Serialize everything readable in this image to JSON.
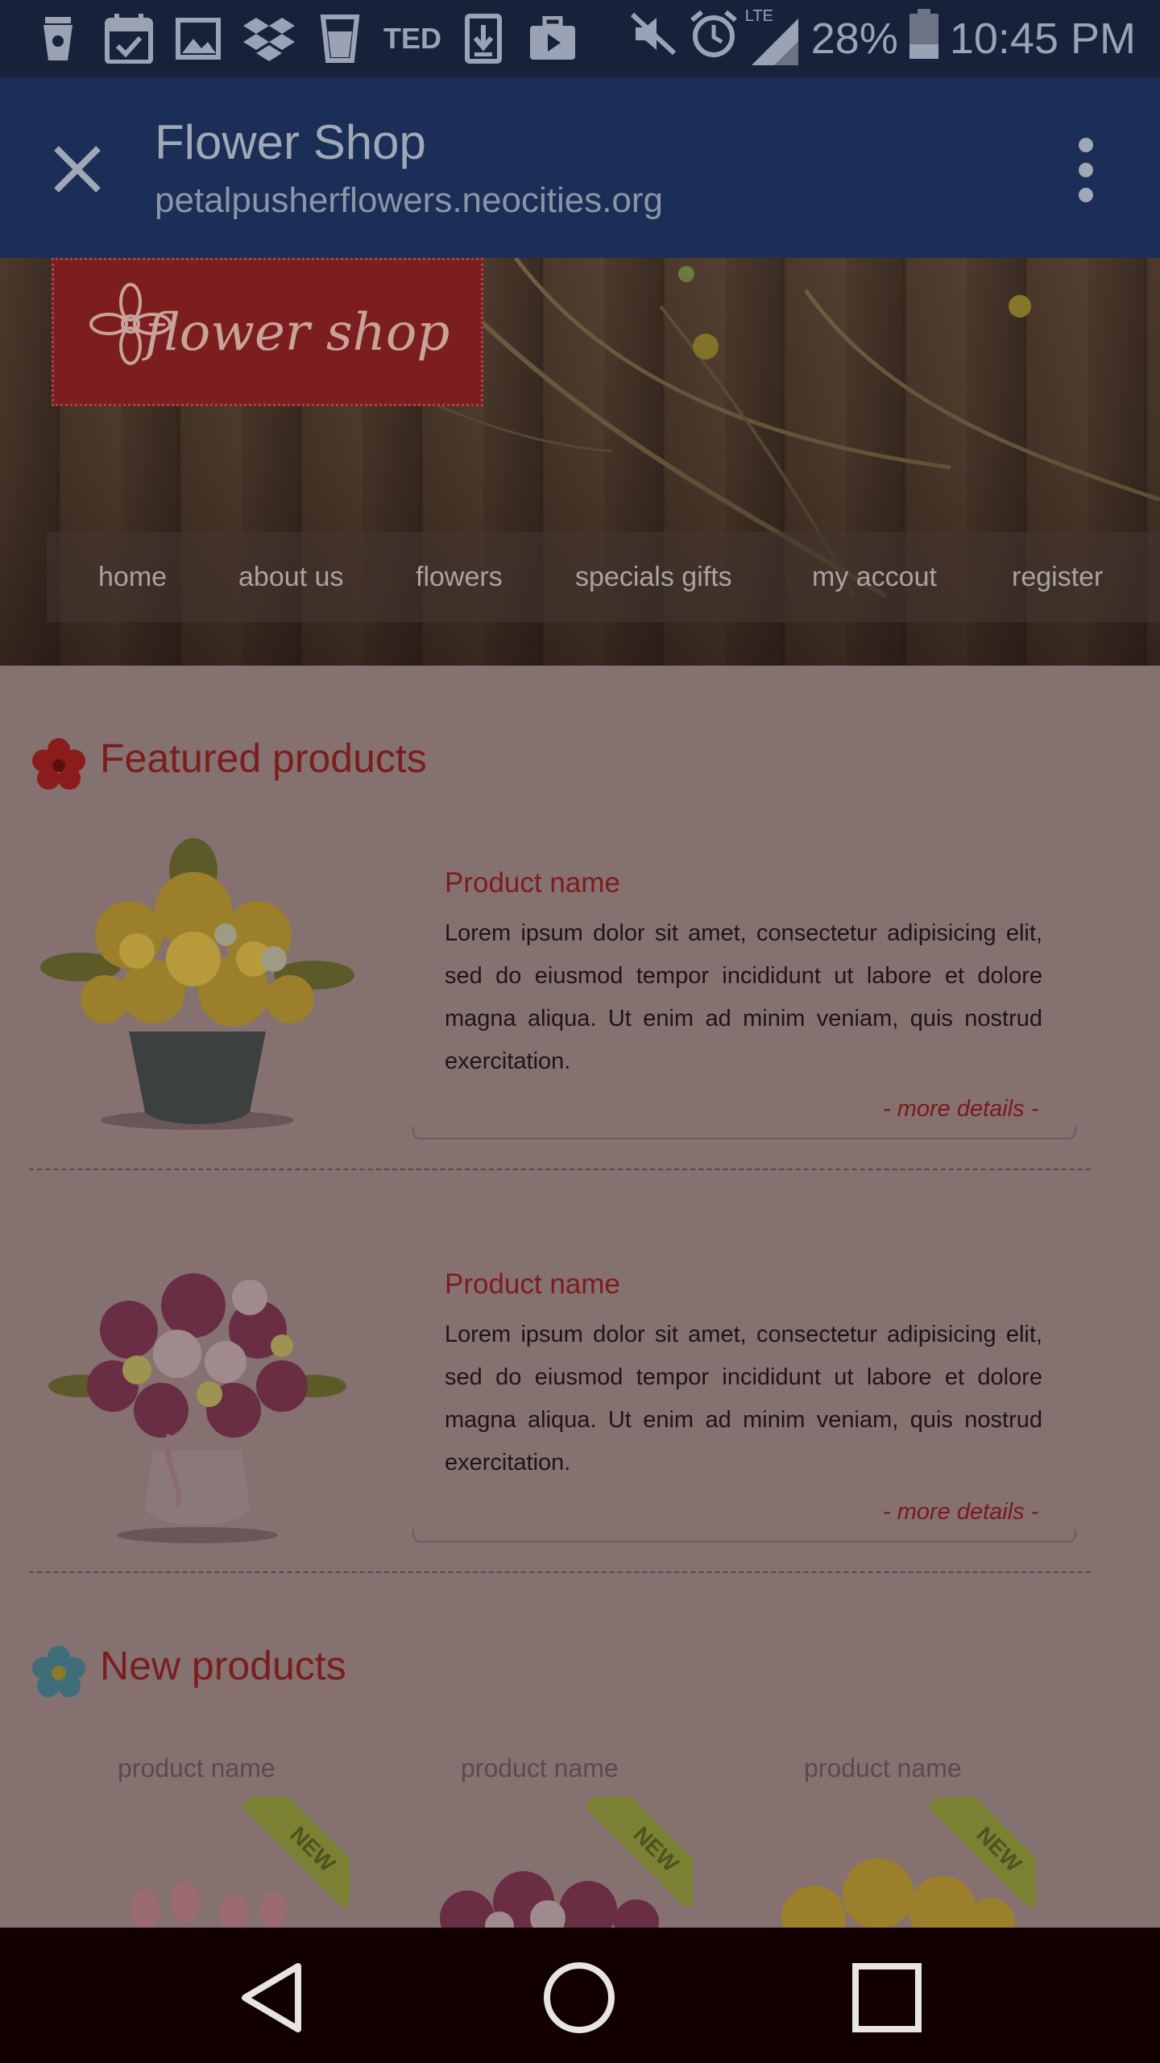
{
  "status_bar": {
    "battery": "28%",
    "time": "10:45 PM",
    "network": "LTE",
    "notification_icons": [
      "coffee-cup-icon",
      "calendar-check-icon",
      "image-icon",
      "dropbox-icon",
      "cup-icon",
      "ted-icon",
      "download-icon",
      "briefcase-play-icon"
    ],
    "ted_label": "TED"
  },
  "app_bar": {
    "title": "Flower Shop",
    "url": "petalpusherflowers.neocities.org"
  },
  "site": {
    "logo_text": "flower shop",
    "nav": [
      "home",
      "about us",
      "flowers",
      "specials gifts",
      "my accout",
      "register"
    ]
  },
  "featured": {
    "title": "Featured products",
    "products": [
      {
        "name": "Product name",
        "description": "Lorem ipsum dolor sit amet, consectetur adipisicing elit, sed do eiusmod tempor incididunt ut labore et dolore magna aliqua. Ut enim ad minim veniam, quis nostrud exercitation.",
        "more": "- more details -"
      },
      {
        "name": "Product name",
        "description": "Lorem ipsum dolor sit amet, consectetur adipisicing elit, sed do eiusmod tempor incididunt ut labore et dolore magna aliqua. Ut enim ad minim veniam, quis nostrud exercitation.",
        "more": "- more details -"
      }
    ]
  },
  "new_products": {
    "title": "New products",
    "items": [
      {
        "name": "product name",
        "badge": "NEW"
      },
      {
        "name": "product name",
        "badge": "NEW"
      },
      {
        "name": "product name",
        "badge": "NEW"
      }
    ]
  },
  "colors": {
    "overlay_page": "#857170",
    "app_bar": "#1a2e57",
    "accent_red": "#7a1d1d"
  }
}
